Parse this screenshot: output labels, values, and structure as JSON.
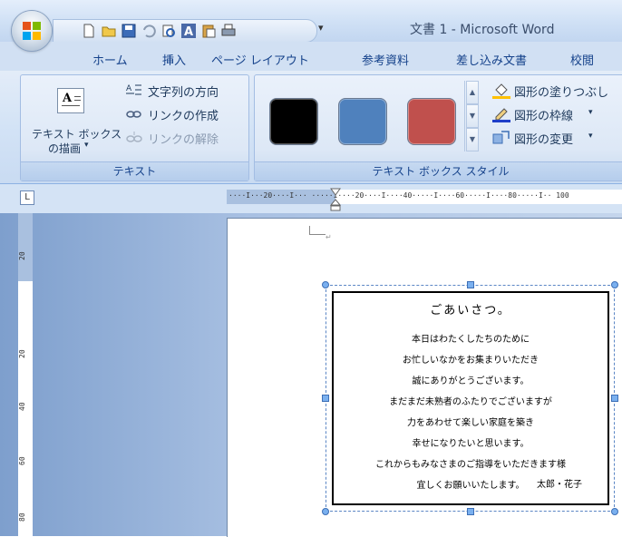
{
  "window": {
    "title": "文書 1 - Microsoft Word"
  },
  "quick_access": {
    "icons": [
      "new-document-icon",
      "open-folder-icon",
      "save-icon",
      "undo-icon",
      "print-preview-icon",
      "text-a-icon",
      "paste-icon",
      "printer-icon"
    ],
    "more": "▾"
  },
  "tabs": [
    "ホーム",
    "挿入",
    "ページ レイアウト",
    "参考資料",
    "差し込み文書",
    "校閲"
  ],
  "ribbon": {
    "text_group": {
      "draw_label_1": "テキスト ボックス",
      "draw_label_2": "の描画",
      "draw_arrow": "▾",
      "text_direction": "文字列の方向",
      "create_link": "リンクの作成",
      "break_link": "リンクの解除",
      "group_label": "テキスト"
    },
    "style_group": {
      "swatches": [
        "#000000",
        "#4f81bd",
        "#c0504d"
      ],
      "shape_fill": "図形の塗りつぶし",
      "shape_outline": "図形の枠線",
      "change_shape": "図形の変更",
      "dropdown_arrow": "▾",
      "group_label": "テキスト ボックス スタイル"
    }
  },
  "ruler": {
    "corner": "L",
    "horizontal_labels": "····I···20····I···   ·····I····20····I····40·····I····60·····I····80·····I··  100",
    "vertical_labels": [
      "20",
      "20",
      "40",
      "60",
      "80"
    ]
  },
  "textbox": {
    "title": "ごあいさつ。",
    "lines": [
      "本日はわたくしたちのために",
      "お忙しいなかをお集まりいただき",
      "誠にありがとうございます。",
      "まだまだ未熟者のふたりでございますが",
      "力をあわせて楽しい家庭を築き",
      "幸せになりたいと思います。",
      "これからもみなさまのご指導をいただきます様",
      "宜しくお願いいたします。"
    ],
    "signature": "太郎・花子",
    "para_mark": "↵"
  }
}
